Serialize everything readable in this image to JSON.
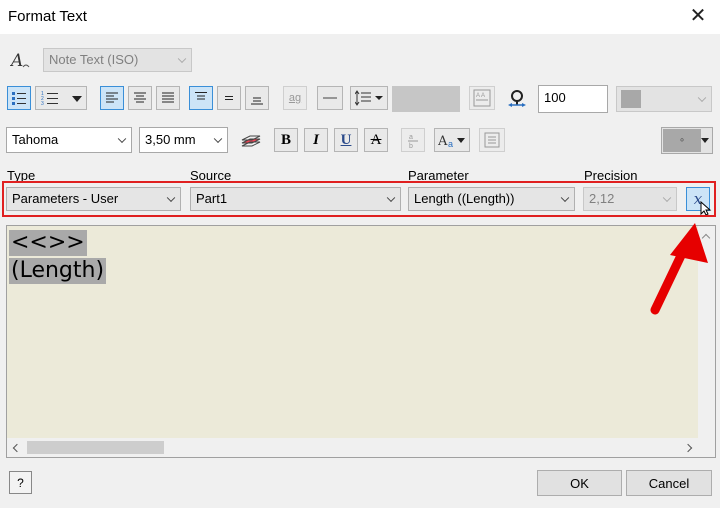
{
  "window": {
    "title": "Format Text"
  },
  "toolbar": {
    "style_value": "Note Text (ISO)",
    "color_box": "#c6c6c6",
    "text_width_value": "100",
    "font_value": "Tahoma",
    "size_value": "3,50 mm",
    "bold": "B",
    "italic": "I",
    "underline": "U",
    "strike": "A",
    "case_glyph": "ag",
    "swatch_color": "#a8a8a8"
  },
  "params": {
    "type_label": "Type",
    "type_value": "Parameters - User",
    "source_label": "Source",
    "source_value": "Part1",
    "parameter_label": "Parameter",
    "parameter_value": "Length ((Length))",
    "precision_label": "Precision",
    "precision_value": "2,12"
  },
  "editor": {
    "line1": "<<>>",
    "line2": "(Length)"
  },
  "footer": {
    "help": "?",
    "ok_label": "OK",
    "cancel_label": "Cancel"
  },
  "colors": {
    "highlight_red": "#e02020",
    "editor_bg": "#ecead9"
  }
}
